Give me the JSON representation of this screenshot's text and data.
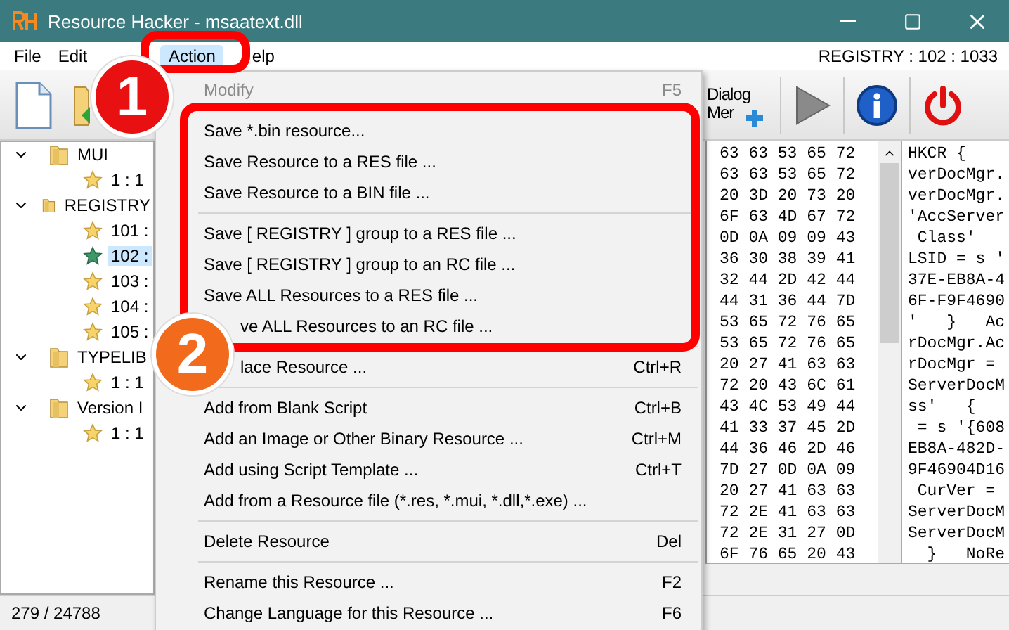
{
  "window": {
    "title": "Resource Hacker - msaatext.dll"
  },
  "menu_bar": {
    "items": [
      {
        "label": "File",
        "selected": false
      },
      {
        "label": "Edit",
        "selected": false
      },
      {
        "label": "Action",
        "selected": true
      },
      {
        "label": "elp",
        "selected": false
      }
    ],
    "resource_path": "REGISTRY : 102 : 1033"
  },
  "toolbar": {
    "dialog_button": "Dialog Mer"
  },
  "tree": [
    {
      "label": "MUI",
      "expanded": true,
      "children": [
        {
          "label": "1 : 1",
          "selected": false
        }
      ]
    },
    {
      "label": "REGISTRY",
      "expanded": true,
      "children": [
        {
          "label": "101 :",
          "selected": false
        },
        {
          "label": "102 :",
          "selected": true
        },
        {
          "label": "103 :",
          "selected": false
        },
        {
          "label": "104 :",
          "selected": false
        },
        {
          "label": "105 :",
          "selected": false
        }
      ]
    },
    {
      "label": "TYPELIB",
      "expanded": true,
      "children": [
        {
          "label": "1 : 1",
          "selected": false
        }
      ]
    },
    {
      "label": "Version I",
      "expanded": true,
      "children": [
        {
          "label": "1 : 1",
          "selected": false
        }
      ]
    }
  ],
  "hex_view": {
    "hex_rows": [
      "63 63 53 65 72",
      "63 63 53 65 72",
      "20 3D 20 73 20",
      "6F 63 4D 67 72",
      "0D 0A 09 09 43",
      "36 30 38 39 41",
      "32 44 2D 42 44",
      "44 31 36 44 7D",
      "53 65 72 76 65",
      "53 65 72 76 65",
      "20 27 41 63 63",
      "72 20 43 6C 61",
      "43 4C 53 49 44",
      "41 33 37 45 2D",
      "44 36 46 2D 46",
      "7D 27 0D 0A 09",
      "20 27 41 63 63",
      "72 2E 41 63 63",
      "72 2E 31 27 0D",
      "6F 76 65 20 43"
    ],
    "text_rows": [
      "HKCR {",
      "verDocMgr.",
      "verDocMgr.",
      "'AccServer",
      " Class'",
      "LSID = s '",
      "37E-EB8A-4",
      "6F-F9F4690",
      "'   }   Ac",
      "rDocMgr.Ac",
      "rDocMgr =",
      "ServerDocM",
      "ss'   {",
      " = s '{608",
      "EB8A-482D-",
      "9F46904D16",
      " CurVer =",
      "ServerDocM",
      "ServerDocM",
      "  }   NoRe"
    ]
  },
  "status_bar": {
    "position": "279 / 24788"
  },
  "action_menu": {
    "items": [
      {
        "kind": "item",
        "label": "Modify",
        "shortcut": "F5",
        "disabled": true
      },
      {
        "kind": "separator"
      },
      {
        "kind": "item",
        "label": "Save *.bin resource...",
        "disabled": false
      },
      {
        "kind": "item",
        "label": "Save Resource to a RES file ...",
        "disabled": false
      },
      {
        "kind": "item",
        "label": "Save Resource to a BIN file ...",
        "disabled": false
      },
      {
        "kind": "separator"
      },
      {
        "kind": "item",
        "label": "Save [ REGISTRY ] group to a RES file ...",
        "disabled": false
      },
      {
        "kind": "item",
        "label": "Save [ REGISTRY ] group to an RC file ...",
        "disabled": false
      },
      {
        "kind": "item",
        "label": "Save ALL Resources to a RES file ...",
        "disabled": false
      },
      {
        "kind": "covered",
        "label": "ve ALL Resources to an RC file ...",
        "disabled": false
      },
      {
        "kind": "separator"
      },
      {
        "kind": "covered",
        "label": "lace Resource ...",
        "shortcut": "Ctrl+R",
        "disabled": false
      },
      {
        "kind": "separator"
      },
      {
        "kind": "item",
        "label": "Add from Blank Script",
        "shortcut": "Ctrl+B",
        "disabled": false
      },
      {
        "kind": "item",
        "label": "Add an Image or Other Binary Resource ...",
        "shortcut": "Ctrl+M",
        "disabled": false
      },
      {
        "kind": "item",
        "label": "Add using Script Template ...",
        "shortcut": "Ctrl+T",
        "disabled": false
      },
      {
        "kind": "item",
        "label": "Add from a Resource file (*.res, *.mui, *.dll,*.exe) ...",
        "disabled": false
      },
      {
        "kind": "separator"
      },
      {
        "kind": "item",
        "label": "Delete Resource",
        "shortcut": "Del",
        "disabled": false
      },
      {
        "kind": "separator"
      },
      {
        "kind": "item",
        "label": "Rename this Resource ...",
        "shortcut": "F2",
        "disabled": false
      },
      {
        "kind": "item",
        "label": "Change Language for this Resource ...",
        "shortcut": "F6",
        "disabled": false
      }
    ]
  },
  "callouts": [
    {
      "label": "1"
    },
    {
      "label": "2"
    }
  ]
}
